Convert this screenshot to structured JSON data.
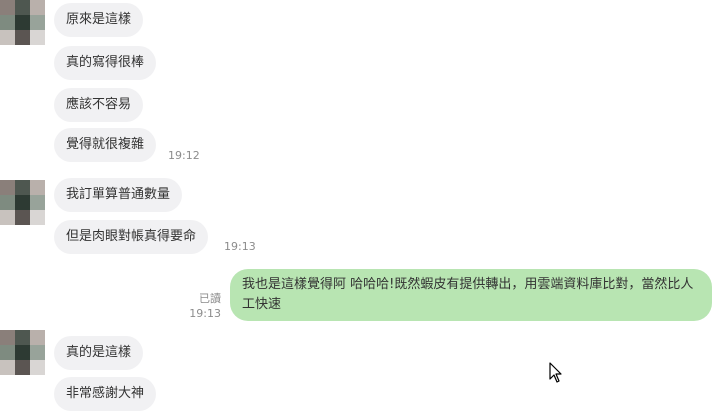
{
  "conversation": {
    "group1": [
      {
        "text": "原來是這樣"
      },
      {
        "text": "真的寫得很棒"
      },
      {
        "text": "應該不容易"
      },
      {
        "text": "覺得就很複雜"
      }
    ],
    "group1_time": "19:12",
    "group2": [
      {
        "text": "我訂單算普通數量"
      },
      {
        "text": "但是肉眼對帳真得要命"
      }
    ],
    "group2_time": "19:13",
    "outgoing": {
      "text": "我也是這樣覺得阿 哈哈哈!既然蝦皮有提供轉出，用雲端資料庫比對，當然比人工快速",
      "read_label": "已讀",
      "time": "19:13"
    },
    "group3": [
      {
        "text": "真的是這樣"
      },
      {
        "text": "非常感謝大神"
      }
    ]
  },
  "avatar": {
    "pixel_colors": [
      "#8a7f7a",
      "#4e5750",
      "#b9b0ab",
      "#7e8b80",
      "#2d3a33",
      "#98a39a",
      "#c8c2be",
      "#5b5552",
      "#d9d6d4"
    ]
  },
  "icons": {
    "cursor": "mouse-pointer-icon"
  }
}
